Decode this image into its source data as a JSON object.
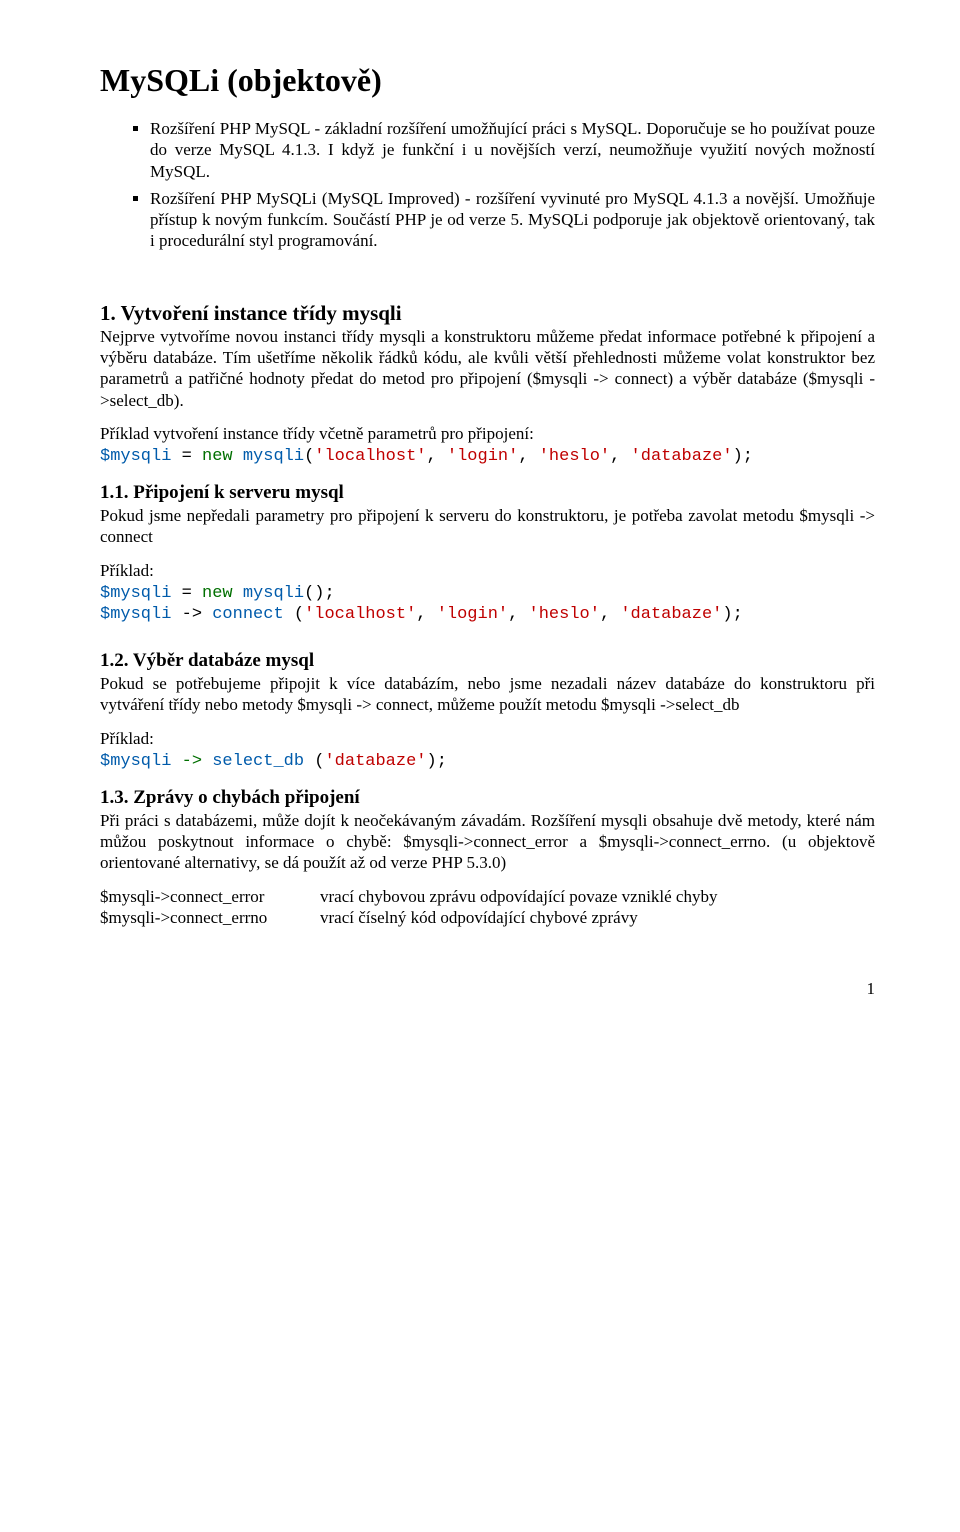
{
  "title": "MySQLi (objektově)",
  "bullets": [
    "Rozšíření PHP MySQL - základní rozšíření umožňující práci s  MySQL. Doporučuje se ho používat pouze do verze MySQL 4.1.3. I když je funkční i u novějších verzí, neumožňuje využití nových možností MySQL.",
    "Rozšíření PHP MySQLi (MySQL Improved) - rozšíření vyvinuté pro MySQL 4.1.3 a novější. Umožňuje přístup k novým funkcím. Součástí PHP je od verze 5. MySQLi podporuje jak objektově orientovaný, tak i procedurální styl programování."
  ],
  "s1": {
    "h": "1. Vytvoření instance třídy mysqli",
    "p1": "Nejprve vytvoříme novou instanci třídy mysqli a konstruktoru můžeme předat informace potřebné k připojení a výběru databáze. Tím ušetříme několik řádků kódu, ale kvůli větší přehlednosti můžeme volat konstruktor bez parametrů a patřičné hodnoty předat do metod pro připojení ($mysqli -> connect) a výběr databáze ($mysqli ->select_db).",
    "exlabel": "Příklad vytvoření instance třídy včetně parametrů pro připojení:",
    "code": {
      "v": "$mysqli",
      "eq": " = ",
      "kw": "new",
      "sp": " ",
      "fn": "mysqli",
      "op": "(",
      "a1": "'localhost'",
      "c": ", ",
      "a2": "'login'",
      "a3": "'heslo'",
      "a4": "'databaze'",
      "cl": ");"
    }
  },
  "s11": {
    "h": "1.1. Připojení k serveru mysql",
    "p": "Pokud jsme nepředali parametry pro připojení k serveru do konstruktoru, je potřeba zavolat metodu $mysqli -> connect",
    "lbl": "Příklad:",
    "code1": {
      "v": "$mysqli",
      "eq": " = ",
      "kw": "new",
      "sp": " ",
      "fn": "mysqli",
      "par": "();"
    },
    "code2": {
      "v": "$mysqli",
      "arr": " -> ",
      "m": "connect",
      "sp": " ",
      "op": "(",
      "a1": "'localhost'",
      "c": ", ",
      "a2": "'login'",
      "a3": "'heslo'",
      "a4": "'databaze'",
      "cl": ");"
    }
  },
  "s12": {
    "h": "1.2. Výběr databáze mysql",
    "p": "Pokud se potřebujeme připojit k více databázím, nebo jsme nezadali název databáze do konstruktoru při vytváření třídy nebo metody $mysqli -> connect, můžeme použít metodu $mysqli ->select_db",
    "lbl": "Příklad:",
    "code": {
      "v": "$mysqli",
      "arr": " -> ",
      "m": "select_db",
      "sp": " ",
      "op": "(",
      "a1": "'databaze'",
      "cl": ");"
    }
  },
  "s13": {
    "h": "1.3. Zprávy o chybách připojení",
    "p": "Při práci s databázemi, může dojít k neočekávaným závadám. Rozšíření mysqli obsahuje dvě metody, které nám můžou poskytnout informace o chybě: $mysqli->connect_error a $mysqli->connect_errno. (u objektově orientované alternativy, se dá použít až od verze PHP 5.3.0)",
    "r1c1": "$mysqli->connect_error",
    "r1c2": "vrací chybovou zprávu odpovídající povaze vzniklé chyby",
    "r2c1": "$mysqli->connect_errno",
    "r2c2": "vrací číselný kód odpovídající chybové zprávy"
  },
  "page": "1"
}
